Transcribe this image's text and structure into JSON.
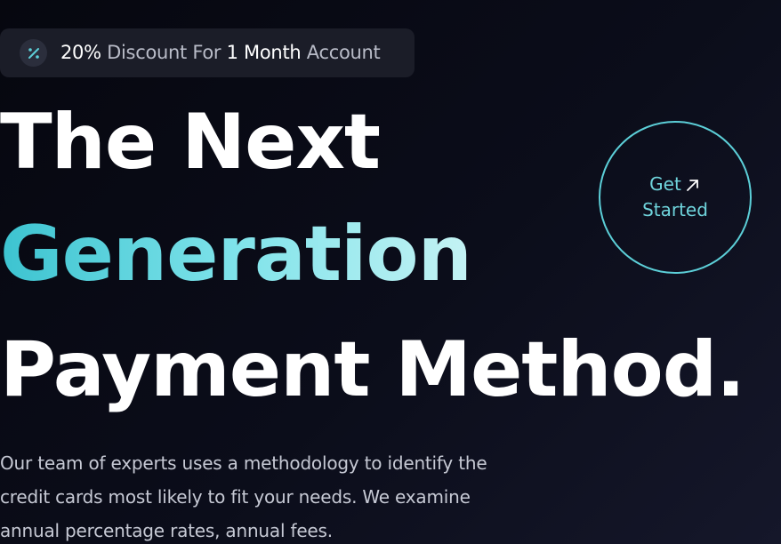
{
  "promo_badge": {
    "icon": "percent-icon",
    "highlight_1": "20%",
    "text_1": " Discount For ",
    "highlight_2": "1 Month",
    "text_2": " Account"
  },
  "hero": {
    "line1": "The Next",
    "line2": "Generation",
    "line3": "Payment Method."
  },
  "cta": {
    "label_1": "Get",
    "label_2": "Started",
    "icon": "arrow-up-right-icon"
  },
  "description": "Our team of experts uses a methodology to identify the credit cards most likely to fit your needs. We examine annual percentage rates, annual fees.",
  "colors": {
    "accent": "#5ccfd8",
    "gradient_start": "#3cc3d0",
    "gradient_end": "#c5f3f4",
    "background": "#0b0d1a"
  }
}
